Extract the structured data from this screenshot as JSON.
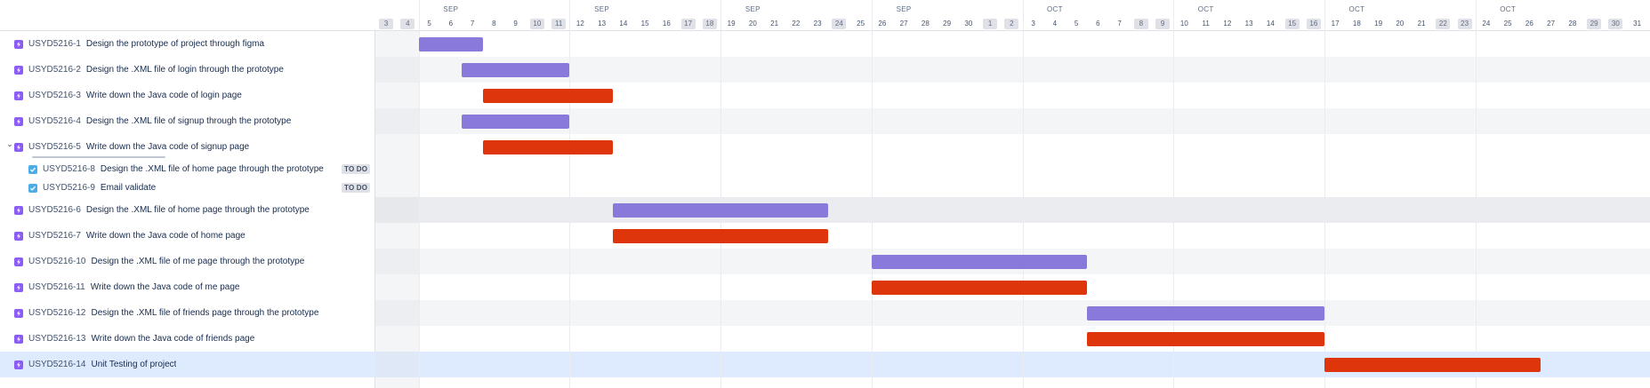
{
  "colors": {
    "purple_bar": "#8879da",
    "red_bar": "#de350b",
    "row_alt": "#f4f5f7",
    "row_selected": "#deebff",
    "row_parent_group": "#ebecf0"
  },
  "header": {
    "months": [
      {
        "label": "SEP",
        "day_index": 3
      },
      {
        "label": "SEP",
        "day_index": 10
      },
      {
        "label": "SEP",
        "day_index": 17
      },
      {
        "label": "SEP",
        "day_index": 24
      },
      {
        "label": "OCT",
        "day_index": 31
      },
      {
        "label": "OCT",
        "day_index": 38
      },
      {
        "label": "OCT",
        "day_index": 45
      },
      {
        "label": "OCT",
        "day_index": 52
      }
    ],
    "days": [
      {
        "d": "3",
        "weekend": true
      },
      {
        "d": "4",
        "weekend": true
      },
      {
        "d": "5"
      },
      {
        "d": "6"
      },
      {
        "d": "7"
      },
      {
        "d": "8"
      },
      {
        "d": "9"
      },
      {
        "d": "10",
        "weekend": true
      },
      {
        "d": "11",
        "weekend": true
      },
      {
        "d": "12"
      },
      {
        "d": "13"
      },
      {
        "d": "14"
      },
      {
        "d": "15"
      },
      {
        "d": "16"
      },
      {
        "d": "17",
        "weekend": true
      },
      {
        "d": "18",
        "weekend": true
      },
      {
        "d": "19"
      },
      {
        "d": "20"
      },
      {
        "d": "21"
      },
      {
        "d": "22"
      },
      {
        "d": "23"
      },
      {
        "d": "24",
        "weekend": true
      },
      {
        "d": "25"
      },
      {
        "d": "26"
      },
      {
        "d": "27"
      },
      {
        "d": "28"
      },
      {
        "d": "29"
      },
      {
        "d": "30"
      },
      {
        "d": "1",
        "weekend": true
      },
      {
        "d": "2",
        "weekend": true
      },
      {
        "d": "3"
      },
      {
        "d": "4"
      },
      {
        "d": "5"
      },
      {
        "d": "6"
      },
      {
        "d": "7"
      },
      {
        "d": "8",
        "weekend": true
      },
      {
        "d": "9",
        "weekend": true
      },
      {
        "d": "10"
      },
      {
        "d": "11"
      },
      {
        "d": "12"
      },
      {
        "d": "13"
      },
      {
        "d": "14"
      },
      {
        "d": "15",
        "weekend": true
      },
      {
        "d": "16",
        "weekend": true
      },
      {
        "d": "17"
      },
      {
        "d": "18"
      },
      {
        "d": "19"
      },
      {
        "d": "20"
      },
      {
        "d": "21"
      },
      {
        "d": "22",
        "weekend": true
      },
      {
        "d": "23",
        "weekend": true
      },
      {
        "d": "24"
      },
      {
        "d": "25"
      },
      {
        "d": "26"
      },
      {
        "d": "27"
      },
      {
        "d": "28"
      },
      {
        "d": "29",
        "weekend": true
      },
      {
        "d": "30",
        "weekend": true
      },
      {
        "d": "31"
      }
    ]
  },
  "rows": [
    {
      "key": "USYD5216-1",
      "summary": "Design the prototype of project through figma",
      "type": "epic",
      "bar": {
        "start": 2,
        "end": 5,
        "color": "purple"
      }
    },
    {
      "key": "USYD5216-2",
      "summary": "Design the .XML file of login through the prototype",
      "type": "epic",
      "bar": {
        "start": 4,
        "end": 9,
        "color": "purple"
      }
    },
    {
      "key": "USYD5216-3",
      "summary": "Write down the Java code of login page",
      "type": "epic",
      "bar": {
        "start": 5,
        "end": 11,
        "color": "red"
      }
    },
    {
      "key": "USYD5216-4",
      "summary": "Design the .XML file of signup through the prototype",
      "type": "epic",
      "bar": {
        "start": 4,
        "end": 9,
        "color": "purple"
      }
    },
    {
      "key": "USYD5216-5",
      "summary": "Write down the Java code of signup page",
      "type": "epic",
      "expanded": true,
      "bar": {
        "start": 5,
        "end": 11,
        "color": "red"
      }
    },
    {
      "key": "USYD5216-8",
      "summary": "Design the .XML file of home page through the prototype",
      "type": "task",
      "child": true,
      "status": "TO DO"
    },
    {
      "key": "USYD5216-9",
      "summary": "Email validate",
      "type": "task",
      "child": true,
      "status": "TO DO"
    },
    {
      "key": "USYD5216-6",
      "summary": "Design the .XML file of home page through the prototype",
      "type": "epic",
      "bar": {
        "start": 11,
        "end": 21,
        "color": "purple"
      }
    },
    {
      "key": "USYD5216-7",
      "summary": "Write down the Java code of home page",
      "type": "epic",
      "bar": {
        "start": 11,
        "end": 21,
        "color": "red"
      }
    },
    {
      "key": "USYD5216-10",
      "summary": "Design the .XML file of me page through the prototype",
      "type": "epic",
      "bar": {
        "start": 23,
        "end": 33,
        "color": "purple"
      }
    },
    {
      "key": "USYD5216-11",
      "summary": "Write down the Java code of me page",
      "type": "epic",
      "bar": {
        "start": 23,
        "end": 33,
        "color": "red"
      }
    },
    {
      "key": "USYD5216-12",
      "summary": "Design the .XML file of friends page through the prototype",
      "type": "epic",
      "bar": {
        "start": 33,
        "end": 44,
        "color": "purple"
      }
    },
    {
      "key": "USYD5216-13",
      "summary": "Write down the Java code of friends page",
      "type": "epic",
      "bar": {
        "start": 33,
        "end": 44,
        "color": "red"
      }
    },
    {
      "key": "USYD5216-14",
      "summary": "Unit Testing of project",
      "type": "epic",
      "selected": true,
      "bar": {
        "start": 44,
        "end": 54,
        "color": "red"
      }
    }
  ]
}
